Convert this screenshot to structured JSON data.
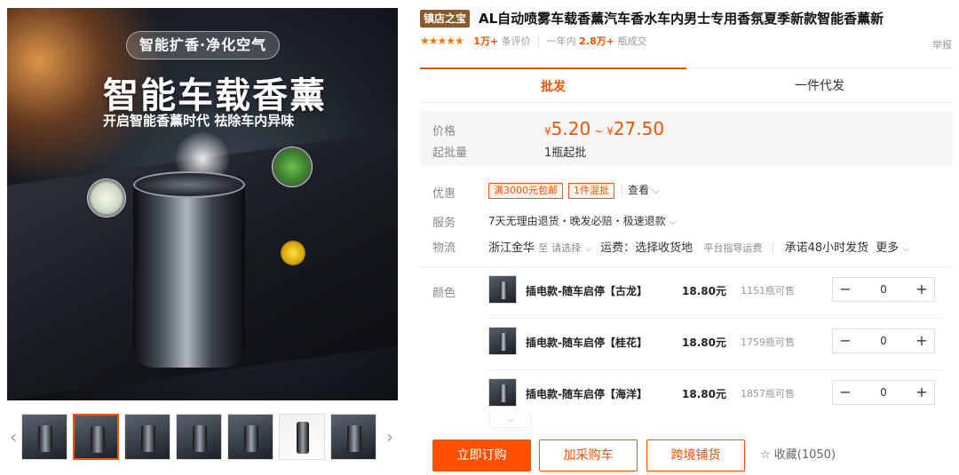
{
  "gallery": {
    "image_headline_pill": "智能扩香·净化空气",
    "image_headline": "智能车载香薰",
    "image_subline": "开启智能香薰时代 祛除车内异味",
    "thumb_prev_icon": "chevron-left-icon",
    "thumb_next_icon": "chevron-right-icon",
    "thumbnail_count": 7,
    "active_thumbnail_index": 1
  },
  "product": {
    "shop_badge": "镇店之宝",
    "title": "AL自动喷雾车载香薰汽车香水车内男士专用香氛夏季新款智能香薰新",
    "rating_stars": "★★★★★",
    "review_count": "1万+",
    "review_label": "条评价",
    "period_label": "一年内",
    "deal_count": "2.8万+",
    "deal_label": "瓶成交",
    "report_label": "举报"
  },
  "tabs": [
    {
      "label": "批发"
    },
    {
      "label": "一件代发"
    }
  ],
  "pricing": {
    "price_label": "价格",
    "currency": "¥",
    "price_min": "5.20",
    "tilde": "~",
    "price_max": "27.50",
    "moq_label": "起批量",
    "moq_value": "1瓶起批"
  },
  "promo": {
    "label": "优惠",
    "tag1": "满3000元包邮",
    "tag2": "1件混批",
    "view": "查看"
  },
  "service": {
    "label": "服务",
    "text": "7天无理由退货・晚发必赔・极速退款"
  },
  "logistics": {
    "label": "物流",
    "origin": "浙江金华",
    "to": "至",
    "select_placeholder": "请选择",
    "freight_text": "运费：选择收货地",
    "guide": "平台指导运费",
    "promise": "承诺48小时发货",
    "more": "更多"
  },
  "sku": {
    "label": "颜色",
    "items": [
      {
        "name": "插电款-随车启停【古龙】",
        "price": "18.80元",
        "stock": "1151瓶可售",
        "qty": "0"
      },
      {
        "name": "插电款-随车启停【桂花】",
        "price": "18.80元",
        "stock": "1759瓶可售",
        "qty": "0"
      },
      {
        "name": "插电款-随车启停【海洋】",
        "price": "18.80元",
        "stock": "1857瓶可售",
        "qty": "0"
      }
    ],
    "minus": "−",
    "plus": "+",
    "collapse_icon": "chevron-down-icon"
  },
  "actions": {
    "buy": "立即订购",
    "cart": "加采购车",
    "cross": "跨境铺货",
    "fav_icon": "star-outline-icon",
    "fav": "收藏(1050)"
  },
  "colors": {
    "accent": "#ff5000",
    "badge": "#8a5a2b"
  }
}
